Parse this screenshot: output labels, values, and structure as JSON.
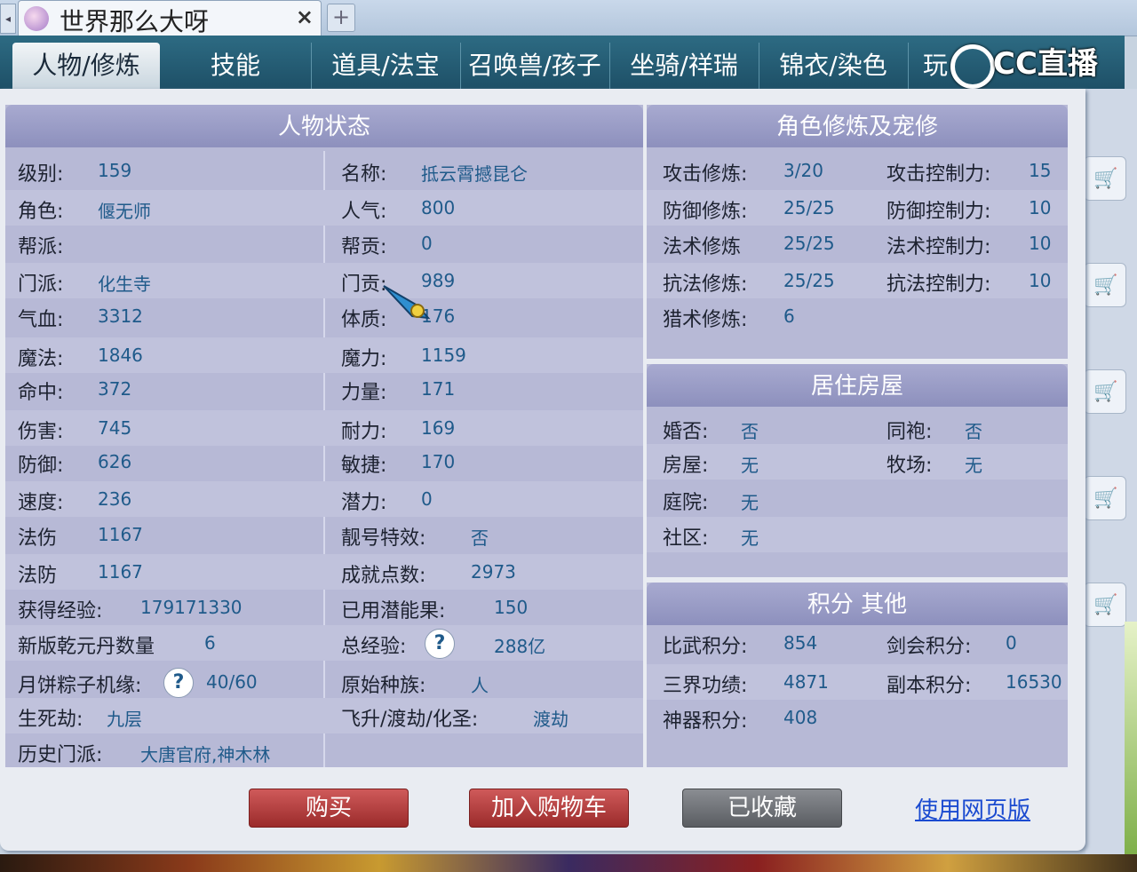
{
  "browser": {
    "tab_title": "世界那么大呀",
    "tab_close": "×",
    "new_tab": "+",
    "scroll_left": "◂"
  },
  "nav": {
    "tabs": [
      "人物/修炼",
      "技能",
      "道具/法宝",
      "召唤兽/孩子",
      "坐骑/祥瑞",
      "锦衣/染色",
      "玩"
    ],
    "watermark": "CC直播"
  },
  "status": {
    "title": "人物状态",
    "left": [
      {
        "label": "级别:",
        "value": "159"
      },
      {
        "label": "角色:",
        "value": "偃无师"
      },
      {
        "label": "帮派:",
        "value": ""
      },
      {
        "label": "门派:",
        "value": "化生寺"
      },
      {
        "label": "气血:",
        "value": "3312"
      },
      {
        "label": "魔法:",
        "value": "1846"
      },
      {
        "label": "命中:",
        "value": "372"
      },
      {
        "label": "伤害:",
        "value": "745"
      },
      {
        "label": "防御:",
        "value": "626"
      },
      {
        "label": "速度:",
        "value": "236"
      },
      {
        "label": "法伤",
        "value": "1167"
      },
      {
        "label": "法防",
        "value": "1167"
      },
      {
        "label": "获得经验:",
        "value": "179171330"
      },
      {
        "label": "新版乾元丹数量",
        "value": "6"
      },
      {
        "label": "月饼粽子机缘:",
        "value": "40/60"
      },
      {
        "label": "生死劫:",
        "value": "九层"
      },
      {
        "label": "历史门派:",
        "value": "大唐官府,神木林"
      }
    ],
    "right": [
      {
        "label": "名称:",
        "value": "抵云霄撼昆仑"
      },
      {
        "label": "人气:",
        "value": "800"
      },
      {
        "label": "帮贡:",
        "value": "0"
      },
      {
        "label": "门贡:",
        "value": "989"
      },
      {
        "label": "体质:",
        "value": "176"
      },
      {
        "label": "魔力:",
        "value": "1159"
      },
      {
        "label": "力量:",
        "value": "171"
      },
      {
        "label": "耐力:",
        "value": "169"
      },
      {
        "label": "敏捷:",
        "value": "170"
      },
      {
        "label": "潜力:",
        "value": "0"
      },
      {
        "label": "靓号特效:",
        "value": "否"
      },
      {
        "label": "成就点数:",
        "value": "2973"
      },
      {
        "label": "已用潜能果:",
        "value": "150"
      },
      {
        "label": "总经验:",
        "value": "288亿"
      },
      {
        "label": "原始种族:",
        "value": "人"
      },
      {
        "label": "飞升/渡劫/化圣:",
        "value": "渡劫"
      }
    ],
    "help_mark": "?"
  },
  "cultivation": {
    "title": "角色修炼及宠修",
    "rows": [
      {
        "label": "攻击修炼:",
        "value": "3/20",
        "label2": "攻击控制力:",
        "value2": "15"
      },
      {
        "label": "防御修炼:",
        "value": "25/25",
        "label2": "防御控制力:",
        "value2": "10"
      },
      {
        "label": "法术修炼",
        "value": "25/25",
        "label2": "法术控制力:",
        "value2": "10"
      },
      {
        "label": "抗法修炼:",
        "value": "25/25",
        "label2": "抗法控制力:",
        "value2": "10"
      },
      {
        "label": "猎术修炼:",
        "value": "6",
        "label2": "",
        "value2": ""
      }
    ]
  },
  "housing": {
    "title": "居住房屋",
    "rows": [
      {
        "label": "婚否:",
        "value": "否",
        "label2": "同袍:",
        "value2": "否"
      },
      {
        "label": "房屋:",
        "value": "无",
        "label2": "牧场:",
        "value2": "无"
      },
      {
        "label": "庭院:",
        "value": "无",
        "label2": "",
        "value2": ""
      },
      {
        "label": "社区:",
        "value": "无",
        "label2": "",
        "value2": ""
      }
    ]
  },
  "points": {
    "title": "积分 其他",
    "rows": [
      {
        "label": "比武积分:",
        "value": "854",
        "label2": "剑会积分:",
        "value2": "0"
      },
      {
        "label": "三界功绩:",
        "value": "4871",
        "label2": "副本积分:",
        "value2": "16530"
      },
      {
        "label": "神器积分:",
        "value": "408",
        "label2": "",
        "value2": ""
      }
    ]
  },
  "actions": {
    "buy": "购买",
    "add_cart": "加入购物车",
    "favorited": "已收藏",
    "web_version": "使用网页版"
  },
  "colors": {
    "nav_bg": "#1e5067",
    "section_header": "#8d90bd",
    "value_text": "#1f5a8a",
    "buy_button": "#9b2b2b"
  }
}
